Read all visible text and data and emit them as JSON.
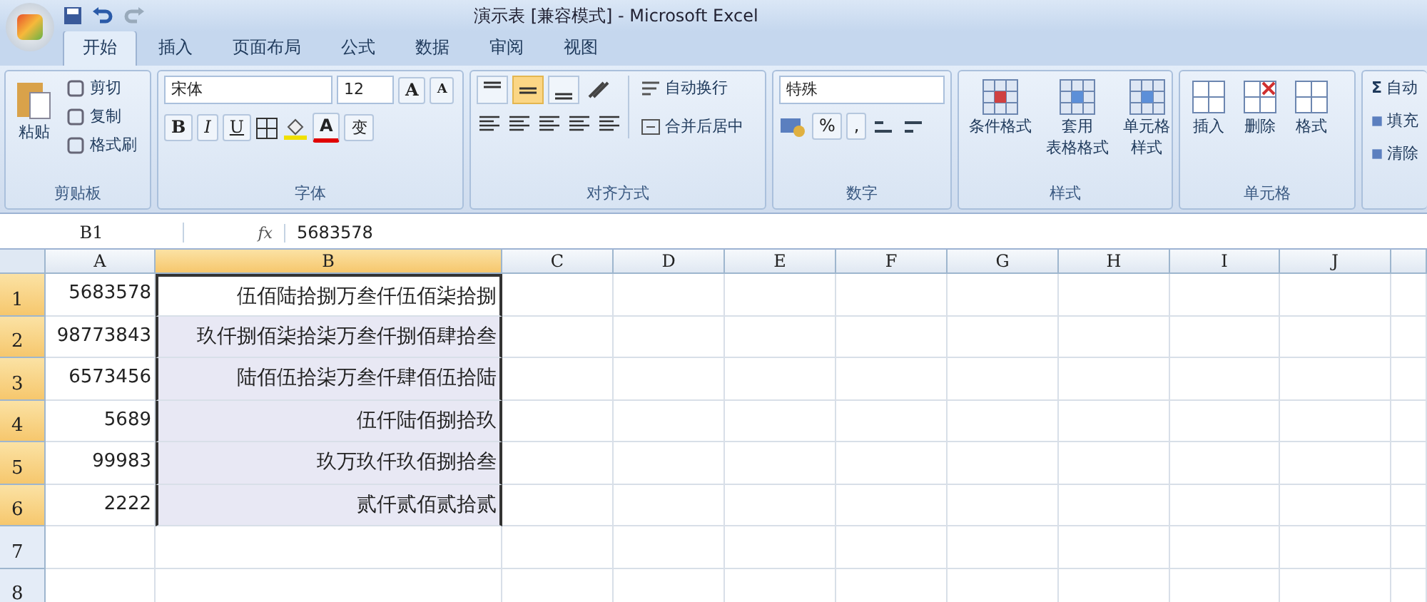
{
  "window": {
    "title": "演示表  [兼容模式] - Microsoft Excel"
  },
  "tabs": [
    {
      "label": "开始",
      "selected": true
    },
    {
      "label": "插入",
      "selected": false
    },
    {
      "label": "页面布局",
      "selected": false
    },
    {
      "label": "公式",
      "selected": false
    },
    {
      "label": "数据",
      "selected": false
    },
    {
      "label": "审阅",
      "selected": false
    },
    {
      "label": "视图",
      "selected": false
    }
  ],
  "clipboard": {
    "paste": "粘贴",
    "items": [
      "剪切",
      "复制",
      "格式刷"
    ],
    "label": "剪贴板"
  },
  "font": {
    "name": "宋体",
    "size": "12",
    "grow": "A",
    "shrink": "A",
    "format_buttons": [
      "B",
      "I",
      "U"
    ],
    "font_color": "A",
    "phonetic": "变",
    "label": "字体"
  },
  "alignment": {
    "vertical": [
      {
        "selected": false
      },
      {
        "selected": true
      },
      {
        "selected": false
      }
    ],
    "wrap": "自动换行",
    "merge": "合并后居中",
    "label": "对齐方式"
  },
  "number": {
    "format": "特殊",
    "percent": "%",
    "comma": ",",
    "label": "数字"
  },
  "styles": {
    "items": [
      [
        "条件格式"
      ],
      [
        "套用",
        "表格格式"
      ],
      [
        "单元格",
        "样式"
      ]
    ],
    "label": "样式"
  },
  "cells": {
    "items": [
      "插入",
      "删除",
      "格式"
    ],
    "label": "单元格"
  },
  "editing": {
    "sigma": "Σ",
    "items": [
      "自动",
      "填充",
      "清除"
    ]
  },
  "formula_bar": {
    "name_box": "B1",
    "fx": "fx",
    "value": "5683578"
  },
  "columns": [
    {
      "label": "A",
      "selected": false
    },
    {
      "label": "B",
      "selected": true
    },
    {
      "label": "C",
      "selected": false
    },
    {
      "label": "D",
      "selected": false
    },
    {
      "label": "E",
      "selected": false
    },
    {
      "label": "F",
      "selected": false
    },
    {
      "label": "G",
      "selected": false
    },
    {
      "label": "H",
      "selected": false
    },
    {
      "label": "I",
      "selected": false
    },
    {
      "label": "J",
      "selected": false
    }
  ],
  "rows": [
    {
      "label": "1",
      "selected": true,
      "cells": [
        {
          "value": "5683578",
          "selected": false
        },
        {
          "value": "伍佰陆拾捌万叁仟伍佰柒拾捌",
          "selected": true,
          "active": true
        }
      ]
    },
    {
      "label": "2",
      "selected": true,
      "cells": [
        {
          "value": "98773843",
          "selected": false
        },
        {
          "value": "玖仟捌佰柒拾柒万叁仟捌佰肆拾叁",
          "selected": true,
          "active": false
        }
      ]
    },
    {
      "label": "3",
      "selected": true,
      "cells": [
        {
          "value": "6573456",
          "selected": false
        },
        {
          "value": "陆佰伍拾柒万叁仟肆佰伍拾陆",
          "selected": true,
          "active": false
        }
      ]
    },
    {
      "label": "4",
      "selected": true,
      "cells": [
        {
          "value": "5689",
          "selected": false
        },
        {
          "value": "伍仟陆佰捌拾玖",
          "selected": true,
          "active": false
        }
      ]
    },
    {
      "label": "5",
      "selected": true,
      "cells": [
        {
          "value": "99983",
          "selected": false
        },
        {
          "value": "玖万玖仟玖佰捌拾叁",
          "selected": true,
          "active": false
        }
      ]
    },
    {
      "label": "6",
      "selected": true,
      "cells": [
        {
          "value": "2222",
          "selected": false
        },
        {
          "value": "贰仟贰佰贰拾贰",
          "selected": true,
          "active": false
        }
      ]
    },
    {
      "label": "7",
      "selected": false,
      "cells": []
    },
    {
      "label": "8",
      "selected": false,
      "cells": []
    }
  ]
}
